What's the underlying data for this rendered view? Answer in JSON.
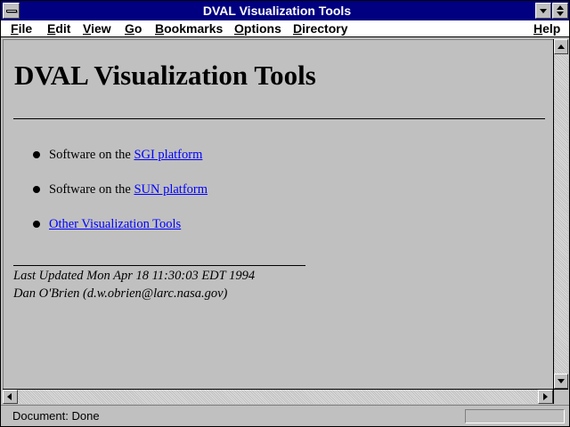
{
  "window": {
    "title": "DVAL Visualization Tools"
  },
  "menu": [
    {
      "label": "File",
      "accel": "F"
    },
    {
      "label": "Edit",
      "accel": "E"
    },
    {
      "label": "View",
      "accel": "V"
    },
    {
      "label": "Go",
      "accel": "G"
    },
    {
      "label": "Bookmarks",
      "accel": "B"
    },
    {
      "label": "Options",
      "accel": "O"
    },
    {
      "label": "Directory",
      "accel": "D"
    },
    {
      "label": "Help",
      "accel": "H"
    }
  ],
  "page": {
    "heading": "DVAL Visualization Tools",
    "list": [
      {
        "prefix": "Software on the ",
        "link": "SGI platform "
      },
      {
        "prefix": "Software on the ",
        "link": "SUN platform "
      },
      {
        "prefix": "",
        "link": "Other Visualization Tools "
      }
    ],
    "address": {
      "updated": "Last Updated Mon Apr 18 11:30:03 EDT 1994",
      "author": "Dan O'Brien (d.w.obrien@larc.nasa.gov)"
    }
  },
  "status": {
    "text": "Document: Done"
  },
  "colors": {
    "titlebar": "#000080",
    "link": "#0000ff",
    "background": "#c0c0c0"
  },
  "icons": {
    "system_menu": "system-menu-icon",
    "minimize": "minimize-icon",
    "maximize": "maximize-icon"
  }
}
